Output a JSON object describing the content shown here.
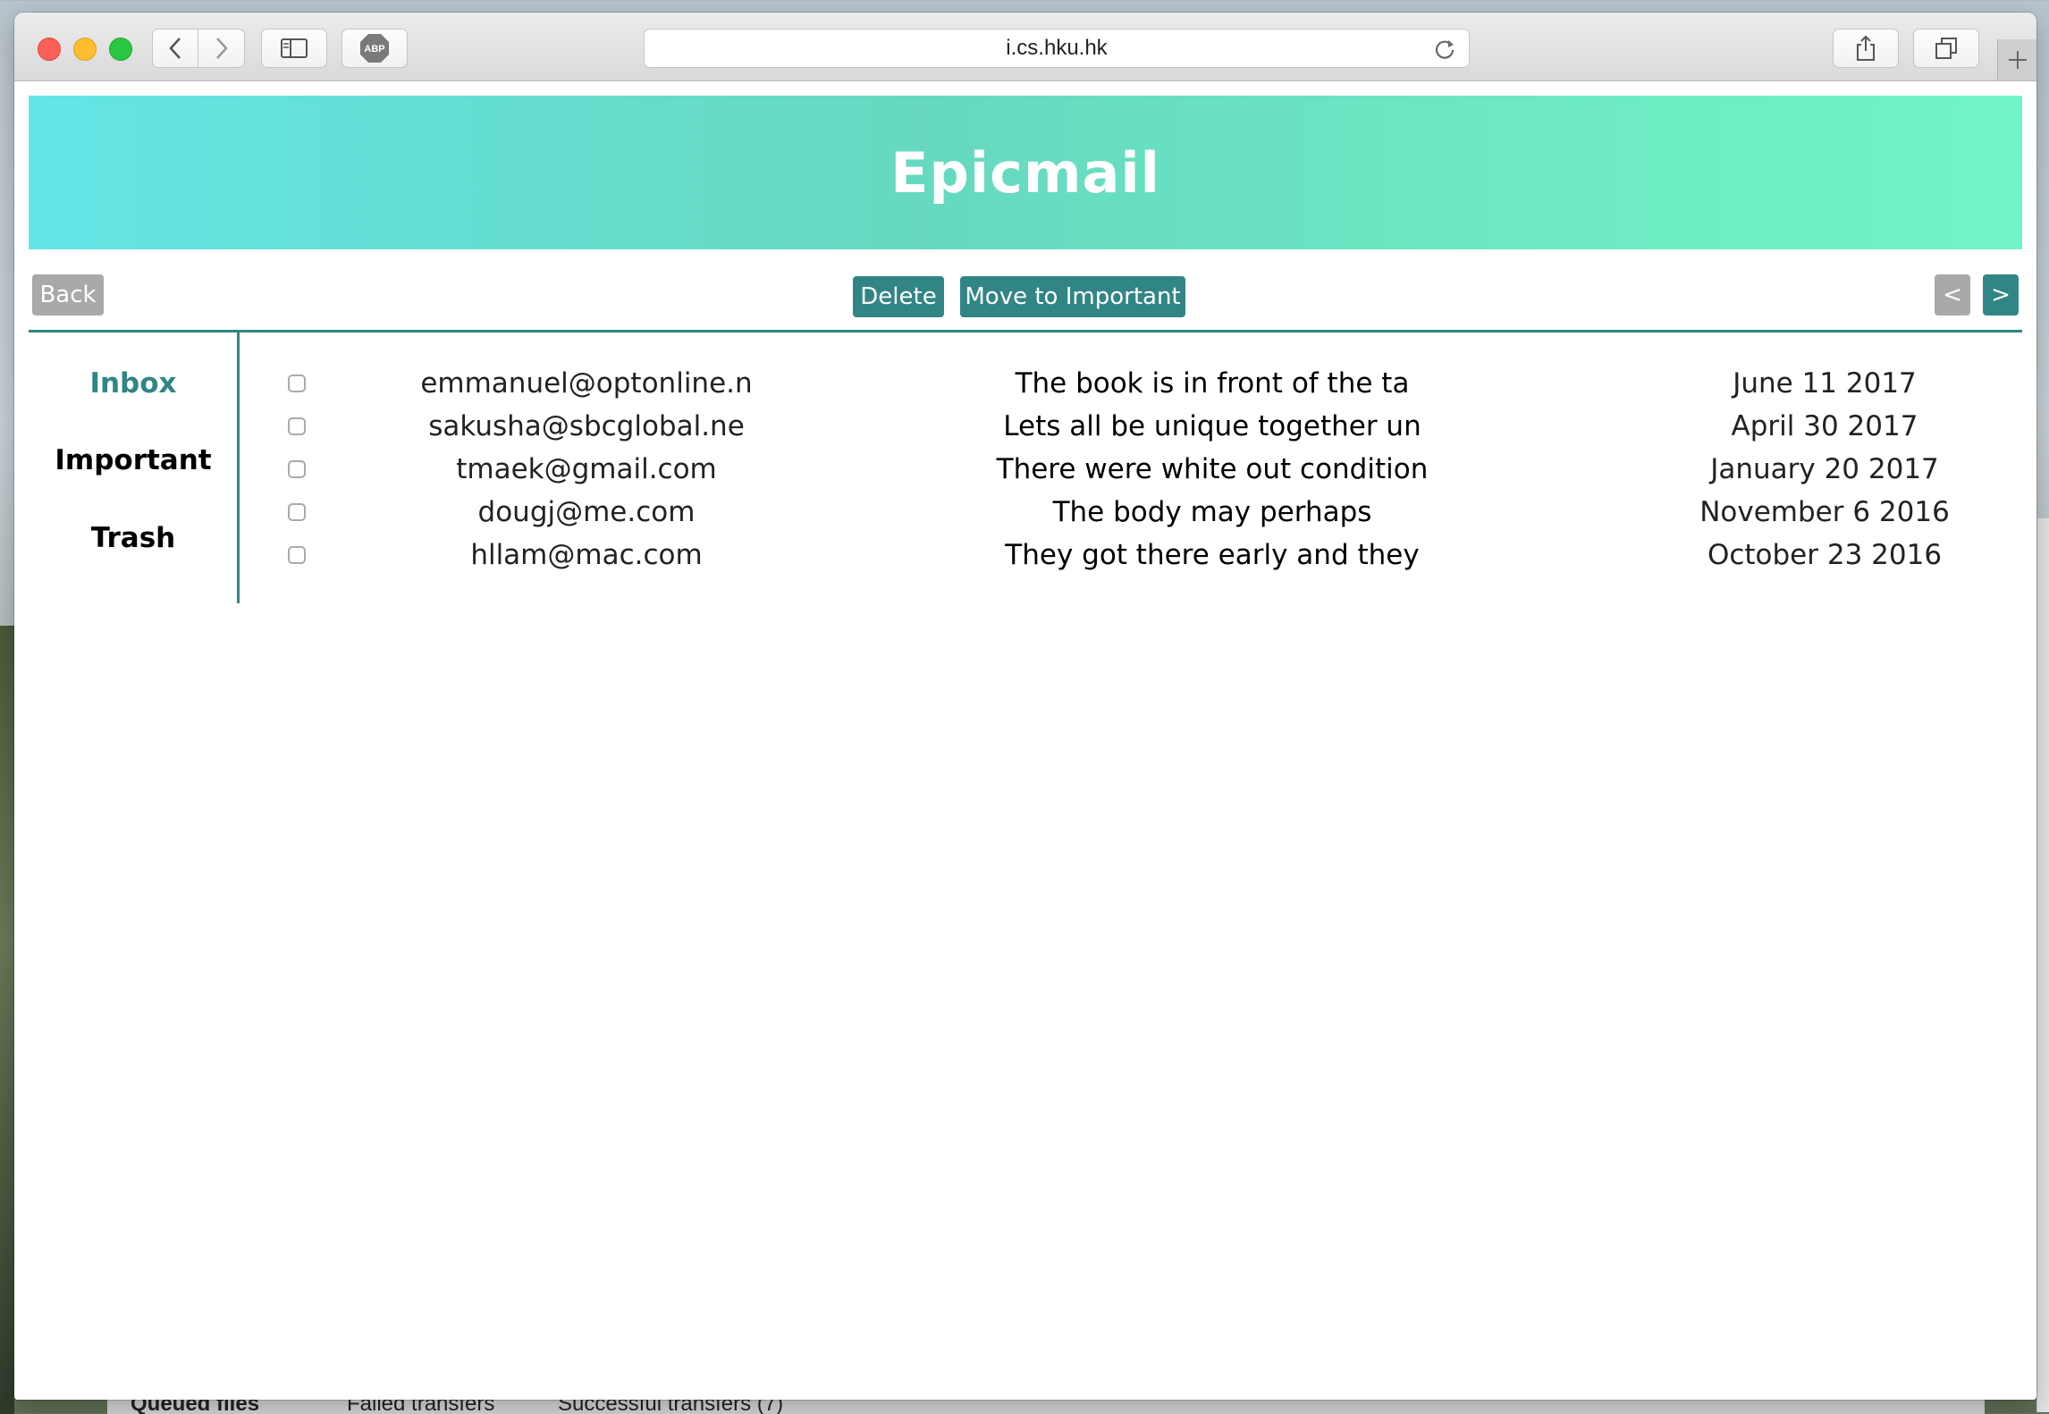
{
  "browser": {
    "url": "i.cs.hku.hk",
    "abp_label": "ABP"
  },
  "app": {
    "title": "Epicmail"
  },
  "actions": {
    "back_label": "Back",
    "delete_label": "Delete",
    "move_label": "Move to Important",
    "prev_label": "<",
    "next_label": ">"
  },
  "folders": [
    {
      "label": "Inbox",
      "active": true
    },
    {
      "label": "Important",
      "active": false
    },
    {
      "label": "Trash",
      "active": false
    }
  ],
  "emails": [
    {
      "from": "emmanuel@optonline.n",
      "subject": "The book is in front of the ta",
      "date": "June 11 2017"
    },
    {
      "from": "sakusha@sbcglobal.ne",
      "subject": "Lets all be unique together un",
      "date": "April 30 2017"
    },
    {
      "from": "tmaek@gmail.com",
      "subject": "There were white out condition",
      "date": "January 20 2017"
    },
    {
      "from": "dougj@me.com",
      "subject": "The body may perhaps",
      "date": "November 6 2016"
    },
    {
      "from": "hllam@mac.com",
      "subject": "They got there early and they",
      "date": "October 23 2016"
    }
  ],
  "background_app": {
    "tabs": [
      "Queued files",
      "Failed transfers",
      "Successful transfers (7)"
    ]
  },
  "colors": {
    "accent": "#328585",
    "banner_start": "#64e4e6",
    "banner_end": "#72f5c6"
  }
}
